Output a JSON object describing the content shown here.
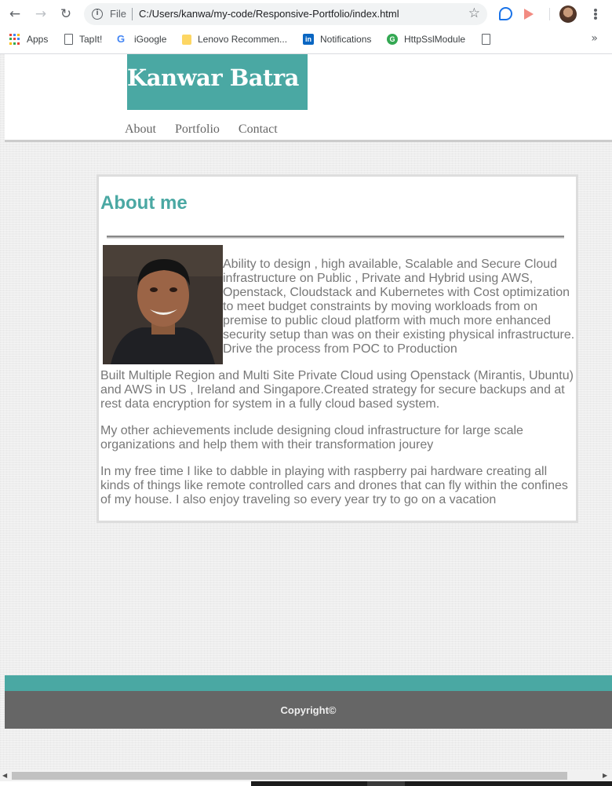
{
  "browser": {
    "url_scheme_label": "File",
    "url": "C:/Users/kanwa/my-code/Responsive-Portfolio/index.html",
    "bookmarks": [
      {
        "label": "Apps",
        "icon": "apps-grid-icon"
      },
      {
        "label": "TapIt!",
        "icon": "page-icon"
      },
      {
        "label": "iGoogle",
        "icon": "google-icon"
      },
      {
        "label": "Lenovo Recommen...",
        "icon": "folder-icon"
      },
      {
        "label": "Notifications",
        "icon": "linkedin-icon"
      },
      {
        "label": "HttpSslModule",
        "icon": "green-g-icon"
      },
      {
        "label": "",
        "icon": "page-icon"
      }
    ]
  },
  "site": {
    "brand": "Kanwar Batra",
    "nav": [
      "About",
      "Portfolio",
      "Contact"
    ],
    "accent_color": "#4aa8a3"
  },
  "about": {
    "heading": "About me",
    "intro": "Ability to design , high available, Scalable and Secure Cloud infrastructure on Public , Private and Hybrid using AWS, Openstack, Cloudstack and Kubernetes with Cost optimization to meet budget constraints by moving workloads from on premise to public cloud platform with much more enhanced security setup than was on their existing physical infrastructure. Drive the process from POC to Production",
    "paragraphs": [
      "Built Multiple Region and Multi Site Private Cloud using Openstack (Mirantis, Ubuntu) and AWS in US , Ireland and Singapore.Created strategy for secure backups and at rest data encryption for system in a fully cloud based system.",
      "My other achievements include designing cloud infrastructure for large scale organizations and help them with their transformation jourey",
      "In my free time I like to dabble in playing with raspberry pai hardware creating all kinds of things like remote controlled cars and drones that can fly within the confines of my house. I also enjoy traveling so every year try to go on a vacation"
    ]
  },
  "footer": {
    "copyright": "Copyright©"
  }
}
